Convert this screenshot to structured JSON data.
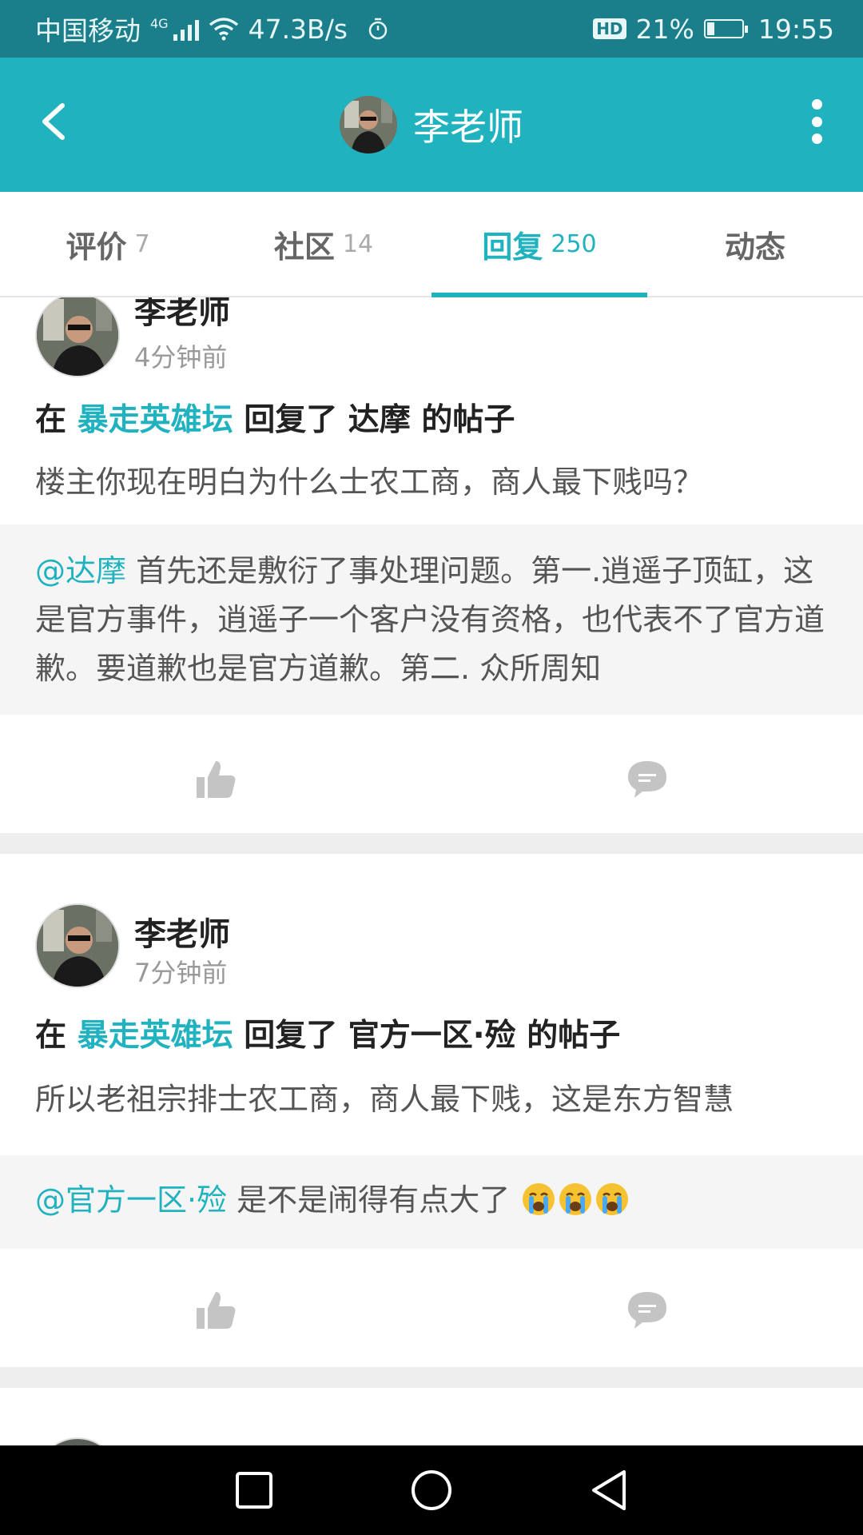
{
  "status_bar": {
    "carrier": "中国移动",
    "network": "4G",
    "speed": "47.3B/s",
    "hd": "HD",
    "battery_pct": "21%",
    "battery_level": 0.21,
    "time": "19:55",
    "icons": [
      "signal-icon",
      "wifi-icon",
      "alarm-icon",
      "battery-icon"
    ]
  },
  "header": {
    "title": "李老师",
    "back_icon": "chevron-left-icon",
    "more_icon": "more-vertical-icon"
  },
  "tabs": [
    {
      "label": "评价",
      "count": "7"
    },
    {
      "label": "社区",
      "count": "14"
    },
    {
      "label": "回复",
      "count": "250",
      "active": true
    },
    {
      "label": "动态",
      "count": ""
    }
  ],
  "posts": [
    {
      "user": "李老师",
      "time": "4分钟前",
      "prefix": "在",
      "forum": "暴走英雄坛",
      "middle": "回复了",
      "target": "达摩",
      "suffix": "的帖子",
      "snippet": "楼主你现在明白为什么士农工商，商人最下贱吗？",
      "mention": "@达摩",
      "quote": " 首先还是敷衍了事处理问题。第一.逍遥子顶缸，这是官方事件，逍遥子一个客户没有资格，也代表不了官方道歉。要道歉也是官方道歉。第二. 众所周知"
    },
    {
      "user": "李老师",
      "time": "7分钟前",
      "prefix": "在",
      "forum": "暴走英雄坛",
      "middle": "回复了",
      "target": "官方一区·殓",
      "suffix": "的帖子",
      "snippet": "所以老祖宗排士农工商，商人最下贱，这是东方智慧",
      "mention": "@官方一区·殓",
      "quote": " 是不是闹得有点大了",
      "emoji_count": 3
    }
  ],
  "colors": {
    "accent": "#20b3bf",
    "status_bar": "#1a7f8b",
    "divider": "#eeeeee"
  }
}
